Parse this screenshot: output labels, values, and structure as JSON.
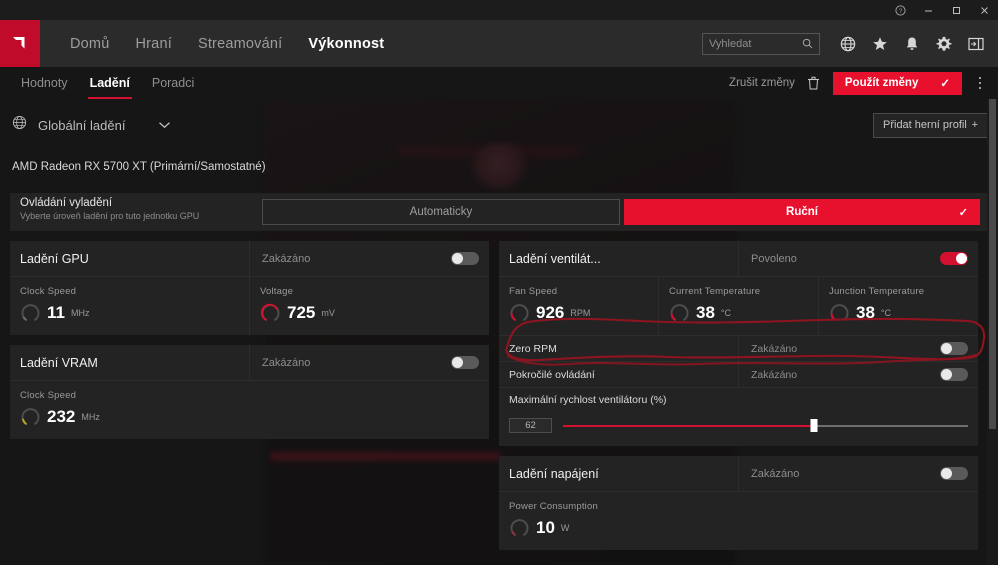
{
  "window": {
    "controls": [
      {
        "name": "help-button",
        "glyph": "?"
      },
      {
        "name": "minimize-button",
        "glyph": "–"
      },
      {
        "name": "maximize-button",
        "glyph": "☐"
      },
      {
        "name": "close-button",
        "glyph": "✕"
      }
    ]
  },
  "nav": {
    "logo_alt": "amd-logo",
    "items": [
      {
        "label": "Domů",
        "active": false
      },
      {
        "label": "Hraní",
        "active": false
      },
      {
        "label": "Streamování",
        "active": false
      },
      {
        "label": "Výkonnost",
        "active": true
      }
    ],
    "search": {
      "placeholder": "Vyhledat",
      "value": ""
    },
    "icons": [
      "globe-icon",
      "star-icon",
      "bell-icon",
      "gear-icon",
      "panel-toggle-icon"
    ]
  },
  "subnav": {
    "tabs": [
      {
        "label": "Hodnoty",
        "active": false
      },
      {
        "label": "Ladění",
        "active": true
      },
      {
        "label": "Poradci",
        "active": false
      }
    ],
    "cancel_label": "Zrušit změny",
    "apply_label": "Použít změny",
    "apply_check": "✓"
  },
  "profile": {
    "selected": "Globální ladění",
    "add_label": "Přidat herní profil",
    "add_plus": "+"
  },
  "gpu": {
    "name": "AMD Radeon RX 5700 XT (Primární/Samostatné)"
  },
  "tune_control": {
    "title": "Ovládání vyladění",
    "subtitle": "Vyberte úroveň ladění pro tuto jednotku GPU",
    "auto_label": "Automaticky",
    "manual_label": "Ruční",
    "selected": "manual"
  },
  "cards": {
    "gpu_tuning": {
      "title": "Ladění GPU",
      "state": "Zakázáno",
      "enabled": false,
      "metrics": [
        {
          "label": "Clock Speed",
          "value": "11",
          "unit": "MHz",
          "gauge_pct": 4,
          "gauge_color": "#6a6a6a"
        },
        {
          "label": "Voltage",
          "value": "725",
          "unit": "mV",
          "gauge_pct": 72,
          "gauge_color": "#d2102f"
        }
      ]
    },
    "vram_tuning": {
      "title": "Ladění VRAM",
      "state": "Zakázáno",
      "enabled": false,
      "metrics": [
        {
          "label": "Clock Speed",
          "value": "232",
          "unit": "MHz",
          "gauge_pct": 13,
          "gauge_color": "#b5a32a"
        }
      ]
    },
    "fan_tuning": {
      "title": "Ladění ventilát...",
      "state": "Povoleno",
      "enabled": true,
      "metrics": [
        {
          "label": "Fan Speed",
          "value": "926",
          "unit": "RPM",
          "gauge_pct": 25,
          "gauge_color": "#d2102f"
        },
        {
          "label": "Current Temperature",
          "value": "38",
          "unit": "°C",
          "gauge_pct": 22,
          "gauge_color": "#d2102f"
        },
        {
          "label": "Junction Temperature",
          "value": "38",
          "unit": "°C",
          "gauge_pct": 22,
          "gauge_color": "#d2102f"
        }
      ],
      "zero_rpm": {
        "label": "Zero RPM",
        "state": "Zakázáno",
        "enabled": false
      },
      "advanced": {
        "label": "Pokročilé ovládání",
        "state": "Zakázáno",
        "enabled": false
      },
      "max_fan": {
        "label": "Maximální rychlost ventilátoru (%)",
        "value": "62"
      }
    },
    "power_tuning": {
      "title": "Ladění napájení",
      "state": "Zakázáno",
      "enabled": false,
      "metrics": [
        {
          "label": "Power Consumption",
          "value": "10",
          "unit": "W",
          "gauge_pct": 8,
          "gauge_color": "#8a3440"
        }
      ]
    }
  },
  "colors": {
    "accent_red": "#e8112d",
    "panel": "#232323",
    "background": "#161616",
    "navbar": "#2b2b2b",
    "annotation_red": "#8e1420"
  }
}
